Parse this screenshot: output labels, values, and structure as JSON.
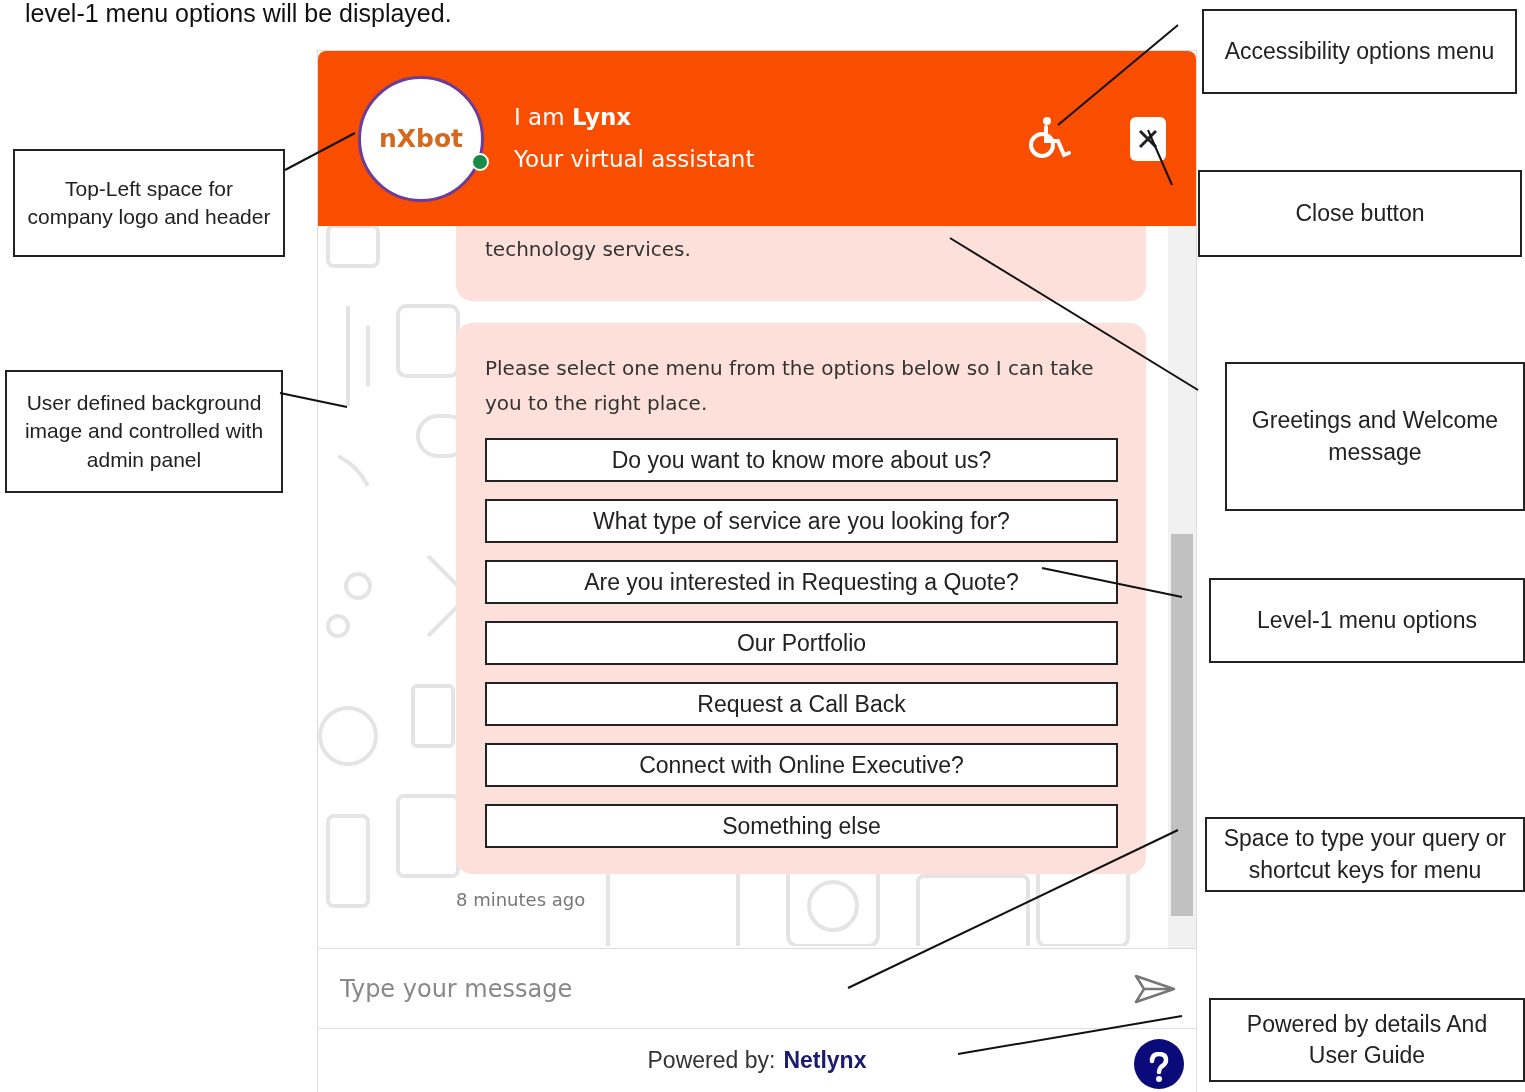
{
  "caption": "level-1 menu options will be displayed.",
  "widget": {
    "header": {
      "logo": "nXbot",
      "online": true,
      "title": "I am **Lynx**",
      "subtitle": "Your virtual assistant"
    },
    "messages": [
      {
        "text": "technology services."
      },
      {
        "text": "Please select one menu from the options below so I can take you to the right place.",
        "options": [
          "Do you want to know more about us?",
          "What type of service are you looking for?",
          "Are you interested in Requesting a Quote?",
          "Our Portfolio",
          "Request a Call Back",
          "Connect with Online Executive?",
          "Something else"
        ]
      }
    ],
    "timestamp": "8 minutes ago",
    "input": {
      "placeholder": "Type your message"
    },
    "footer": {
      "powered_label": "Powered by:",
      "powered_link": "Netlynx"
    }
  },
  "annotations": [
    {
      "text": "Accessibility options menu",
      "kind": "right"
    },
    {
      "text": "Close button",
      "kind": "right"
    },
    {
      "text": "Top-Left space for company logo and header",
      "kind": "left"
    },
    {
      "text": "User defined background image and controlled with admin panel",
      "kind": "left"
    },
    {
      "text": "Greetings and Welcome message",
      "kind": "right"
    },
    {
      "text": "Level-1 menu options",
      "kind": "right"
    },
    {
      "text": "Space to type your query or shortcut keys for menu",
      "kind": "right"
    },
    {
      "text": "Powered by details And User Guide",
      "kind": "right"
    }
  ]
}
